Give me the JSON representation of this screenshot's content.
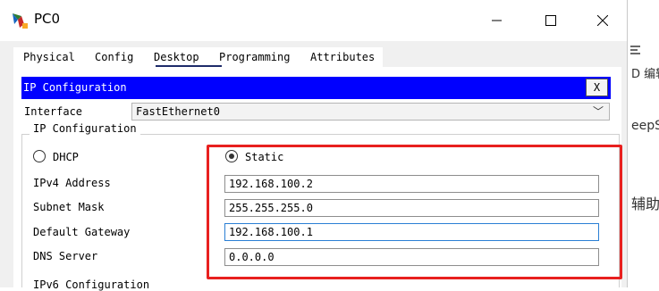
{
  "window": {
    "title": "PC0"
  },
  "tabs": [
    "Physical",
    "Config",
    "Desktop",
    "Programming",
    "Attributes"
  ],
  "active_tab": "Desktop",
  "dialog": {
    "title": "IP Configuration",
    "close_label": "X"
  },
  "interface": {
    "label": "Interface",
    "value": "FastEthernet0"
  },
  "ip_config": {
    "group_label": "IP Configuration",
    "dhcp_label": "DHCP",
    "static_label": "Static",
    "selected_mode": "Static",
    "ipv4_label": "IPv4 Address",
    "ipv4_value": "192.168.100.2",
    "mask_label": "Subnet Mask",
    "mask_value": "255.255.255.0",
    "gateway_label": "Default Gateway",
    "gateway_value": "192.168.100.1",
    "dns_label": "DNS Server",
    "dns_value": "0.0.0.0"
  },
  "ipv6": {
    "group_label": "IPv6 Configuration"
  },
  "background": {
    "text1": "D 编辑",
    "text2": "eepSe",
    "text3": "辅助"
  },
  "colors": {
    "header_bar": "#0000ff",
    "highlight_box": "#e8201f",
    "focus_border": "#2a7fd4"
  }
}
